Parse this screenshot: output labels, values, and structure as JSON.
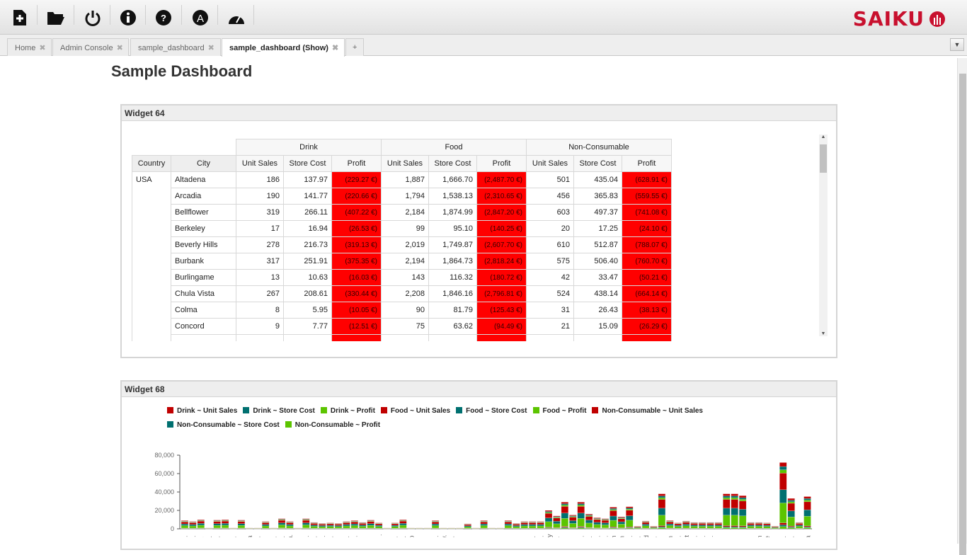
{
  "toolbar": {
    "buttons": [
      "new-query",
      "open-query",
      "logout",
      "about",
      "help",
      "admin",
      "performance"
    ],
    "logo": "saiku"
  },
  "tabs": [
    {
      "label": "Home"
    },
    {
      "label": "Admin Console"
    },
    {
      "label": "sample_dashboard"
    },
    {
      "label": "sample_dashboard (Show)",
      "active": true
    },
    {
      "label": "+"
    }
  ],
  "page_title": "Sample Dashboard",
  "widget64": {
    "title": "Widget 64",
    "groups": [
      "Drink",
      "Food",
      "Non-Consumable"
    ],
    "headers": [
      "Country",
      "City",
      "Unit Sales",
      "Store Cost",
      "Profit"
    ],
    "country": "USA",
    "rows": [
      [
        "Altadena",
        "186",
        "137.97",
        "(229.27 €)",
        "1,887",
        "1,666.70",
        "(2,487.70 €)",
        "501",
        "435.04",
        "(628.91 €)"
      ],
      [
        "Arcadia",
        "190",
        "141.77",
        "(220.66 €)",
        "1,794",
        "1,538.13",
        "(2,310.65 €)",
        "456",
        "365.83",
        "(559.55 €)"
      ],
      [
        "Bellflower",
        "319",
        "266.11",
        "(407.22 €)",
        "2,184",
        "1,874.99",
        "(2,847.20 €)",
        "603",
        "497.37",
        "(741.08 €)"
      ],
      [
        "Berkeley",
        "17",
        "16.94",
        "(26.53 €)",
        "99",
        "95.10",
        "(140.25 €)",
        "20",
        "17.25",
        "(24.10 €)"
      ],
      [
        "Beverly Hills",
        "278",
        "216.73",
        "(319.13 €)",
        "2,019",
        "1,749.87",
        "(2,607.70 €)",
        "610",
        "512.87",
        "(788.07 €)"
      ],
      [
        "Burbank",
        "317",
        "251.91",
        "(375.35 €)",
        "2,194",
        "1,864.73",
        "(2,818.24 €)",
        "575",
        "506.40",
        "(760.70 €)"
      ],
      [
        "Burlingame",
        "13",
        "10.63",
        "(16.03 €)",
        "143",
        "116.32",
        "(180.72 €)",
        "42",
        "33.47",
        "(50.21 €)"
      ],
      [
        "Chula Vista",
        "267",
        "208.61",
        "(330.44 €)",
        "2,208",
        "1,846.16",
        "(2,796.81 €)",
        "524",
        "438.14",
        "(664.14 €)"
      ],
      [
        "Colma",
        "8",
        "5.95",
        "(10.05 €)",
        "90",
        "81.79",
        "(125.43 €)",
        "31",
        "26.43",
        "(38.13 €)"
      ],
      [
        "Concord",
        "9",
        "7.77",
        "(12.51 €)",
        "75",
        "63.62",
        "(94.49 €)",
        "21",
        "15.09",
        "(26.29 €)"
      ]
    ]
  },
  "widget68": {
    "title": "Widget 68"
  },
  "chart_data": {
    "type": "bar",
    "stacked": true,
    "yticks": [
      "80,000",
      "60,000",
      "40,000",
      "20,000",
      "0"
    ],
    "ylim": [
      0,
      80000
    ],
    "series": [
      {
        "name": "Drink ~ Unit Sales",
        "color": "#c00000",
        "share": 0.03
      },
      {
        "name": "Drink ~ Store Cost",
        "color": "#007070",
        "share": 0.025
      },
      {
        "name": "Drink ~ Profit",
        "color": "#5cc400",
        "share": 0.035
      },
      {
        "name": "Food ~ Unit Sales",
        "color": "#c00000",
        "share": 0.25
      },
      {
        "name": "Food ~ Store Cost",
        "color": "#007070",
        "share": 0.2
      },
      {
        "name": "Food ~ Profit",
        "color": "#5cc400",
        "share": 0.3
      },
      {
        "name": "Non-Consumable ~ Unit Sales",
        "color": "#c00000",
        "share": 0.06
      },
      {
        "name": "Non-Consumable ~ Store Cost",
        "color": "#007070",
        "share": 0.05
      },
      {
        "name": "Non-Consumable ~ Profit",
        "color": "#5cc400",
        "share": 0.05
      }
    ],
    "categories": [
      "ad.",
      "ad.",
      "llfl.",
      "ke.",
      "ve.",
      "rb.",
      "lin.",
      "a .",
      "ma",
      "nc.",
      "ro.",
      "ly .",
      "vn.",
      "Ca.",
      "m.",
      "en.",
      "os.",
      "pe.",
      "Jo.",
      "M.",
      "ke.",
      "no.",
      "ol.",
      "g .",
      "es .",
      "V.",
      "lio.",
      "vp.",
      "ato",
      "la.",
      "o .",
      "no.",
      "dw.",
      "ch.",
      "n .",
      "n .",
      "n .",
      "n .",
      "J..",
      "a .",
      "a .",
      "in.",
      "ra.",
      "st .",
      "od.",
      "any",
      "av.",
      "vv.",
      "e .",
      "oa.",
      "va.",
      "eg.",
      "da.",
      "em",
      "inn",
      "od.",
      "ac.",
      "ard",
      "lin.",
      "m.",
      "ien",
      "no.",
      "rett",
      "aq.",
      "da.",
      "nn.",
      "ry.",
      "m.",
      "rt .",
      "al.",
      "m.",
      "ton",
      "ttle",
      "dr.",
      "ok.",
      "co.",
      "a .",
      "ma"
    ],
    "totals": [
      9000,
      8000,
      10000,
      1000,
      9500,
      10000,
      1000,
      9500,
      1000,
      1000,
      8000,
      1000,
      11000,
      8000,
      1000,
      11000,
      7000,
      6000,
      6500,
      6000,
      8000,
      9000,
      7000,
      9500,
      6500,
      1000,
      6500,
      10000,
      1000,
      1000,
      1000,
      9000,
      1000,
      1000,
      1000,
      5500,
      1000,
      9000,
      1000,
      1000,
      9000,
      6000,
      8000,
      8000,
      8000,
      20000,
      14000,
      29000,
      15000,
      29000,
      16000,
      12000,
      11000,
      23500,
      13000,
      24000,
      3000,
      8500,
      3000,
      38000,
      9000,
      6500,
      8500,
      7000,
      7000,
      7000,
      7000,
      38000,
      38000,
      36000,
      7000,
      7000,
      6500,
      3000,
      72000,
      33000,
      7000,
      35000
    ]
  }
}
